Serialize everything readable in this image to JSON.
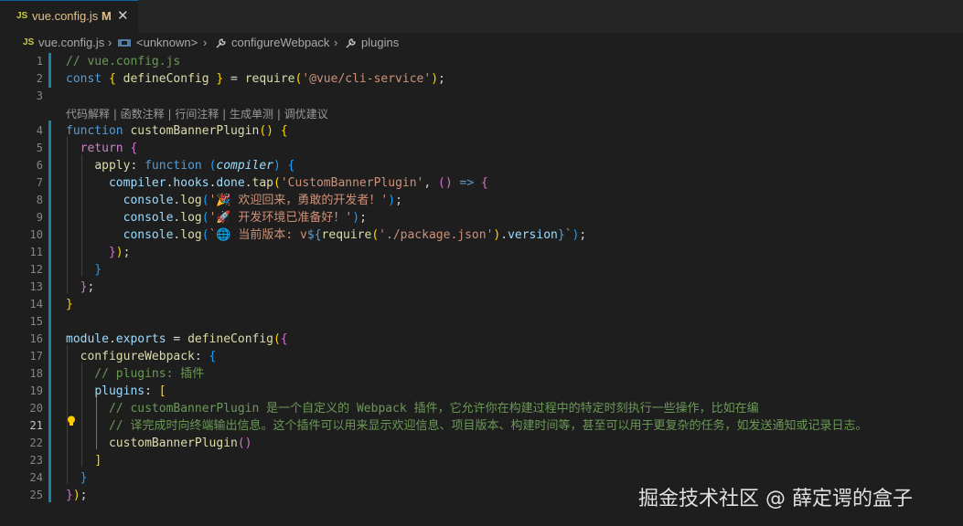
{
  "tab": {
    "icon": "JS",
    "title": "vue.config.js",
    "modified": "M",
    "close": "✕"
  },
  "breadcrumb": {
    "file_icon": "JS",
    "file": "vue.config.js",
    "sep": "›",
    "unknown": "<unknown>",
    "method1": "configureWebpack",
    "method2": "plugins"
  },
  "codelens": "代码解释 | 函数注释 | 行间注释 | 生成单测 | 调优建议",
  "lines": [
    "// vue.config.js",
    "const { defineConfig } = require('@vue/cli-service');",
    "",
    "function customBannerPlugin() {",
    "  return {",
    "    apply: function (compiler) {",
    "      compiler.hooks.done.tap('CustomBannerPlugin', () => {",
    "        console.log('🎉 欢迎回来，勇敢的开发者！');",
    "        console.log('🚀 开发环境已准备好！');",
    "        console.log(`🌐 当前版本: v${require('./package.json').version}`);",
    "      });",
    "    }",
    "  };",
    "}",
    "",
    "module.exports = defineConfig({",
    "  configureWebpack: {",
    "    // plugins: 插件",
    "    plugins: [",
    "      // customBannerPlugin 是一个自定义的 Webpack 插件，它允许你在构建过程中的特定时刻执行一些操作，比如在编",
    "      // 译完成时向终端输出信息。这个插件可以用来显示欢迎信息、项目版本、构建时间等，甚至可以用于更复杂的任务，如发送通知或记录日志。",
    "      customBannerPlugin()",
    "    ]",
    "  }",
    "});"
  ],
  "line_numbers": [
    "1",
    "2",
    "3",
    "4",
    "5",
    "6",
    "7",
    "8",
    "9",
    "10",
    "11",
    "12",
    "13",
    "14",
    "15",
    "16",
    "17",
    "18",
    "19",
    "20",
    "21",
    "22",
    "23",
    "24",
    "25"
  ],
  "watermark": "掘金技术社区 @ 薛定谔的盒子"
}
